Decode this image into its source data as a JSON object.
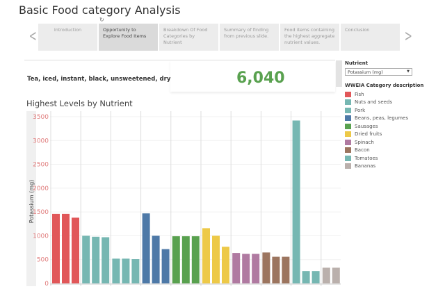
{
  "title": "Basic Food category Analysis",
  "story": {
    "points": [
      {
        "label": "Introduction",
        "active": false
      },
      {
        "label": "Opportunity to Explore Food Items",
        "active": true
      },
      {
        "label": "Breakdown Of Food Categories by Nutrient",
        "active": false
      },
      {
        "label": "Summary of finding from previous slide.",
        "active": false
      },
      {
        "label": "Food items containing the highest aggregate nutrient values.",
        "active": false
      },
      {
        "label": "Conclusion",
        "active": false
      }
    ]
  },
  "kpi": {
    "item": "Tea, iced, instant, black, unsweetened, dry",
    "value": "6,040",
    "color": "#59a14f"
  },
  "filter": {
    "label": "Nutrient",
    "value": "Potassium (mg)"
  },
  "legend": {
    "title": "WWEIA Category description",
    "items": [
      {
        "label": "Fish",
        "color": "#e15759"
      },
      {
        "label": "Nuts and seeds",
        "color": "#76b7b2"
      },
      {
        "label": "Pork",
        "color": "#76b7b2"
      },
      {
        "label": "Beans, peas, legumes",
        "color": "#4e79a7"
      },
      {
        "label": "Sausages",
        "color": "#59a14f"
      },
      {
        "label": "Dried fruits",
        "color": "#edc948"
      },
      {
        "label": "Spinach",
        "color": "#b07aa1"
      },
      {
        "label": "Bacon",
        "color": "#9c755f"
      },
      {
        "label": "Tomatoes",
        "color": "#76b7b2"
      },
      {
        "label": "Bananas",
        "color": "#bab0ac"
      }
    ]
  },
  "chart_data": {
    "type": "bar",
    "title": "Highest Levels by Nutrient",
    "ylabel": "Potassium (mg)",
    "ylim": [
      0,
      3500
    ],
    "yticks": [
      0,
      500,
      1000,
      1500,
      2000,
      2500,
      3000,
      3500
    ],
    "groups": [
      {
        "category": "Fish",
        "values": [
          1460,
          1460,
          1380
        ]
      },
      {
        "category": "Nuts and seeds",
        "values": [
          1000,
          980,
          970
        ]
      },
      {
        "category": "Pork",
        "values": [
          520,
          520,
          510
        ]
      },
      {
        "category": "Beans, peas, legumes",
        "values": [
          1470,
          1000,
          720
        ]
      },
      {
        "category": "Sausages",
        "values": [
          990,
          990,
          990
        ]
      },
      {
        "category": "Dried fruits",
        "values": [
          1160,
          1000,
          770
        ]
      },
      {
        "category": "Spinach",
        "values": [
          640,
          620,
          620
        ]
      },
      {
        "category": "Bacon",
        "values": [
          650,
          560,
          560
        ]
      },
      {
        "category": "Tomatoes",
        "values": [
          3420,
          260,
          260
        ]
      },
      {
        "category": "Bananas",
        "values": [
          330,
          330
        ]
      }
    ]
  }
}
